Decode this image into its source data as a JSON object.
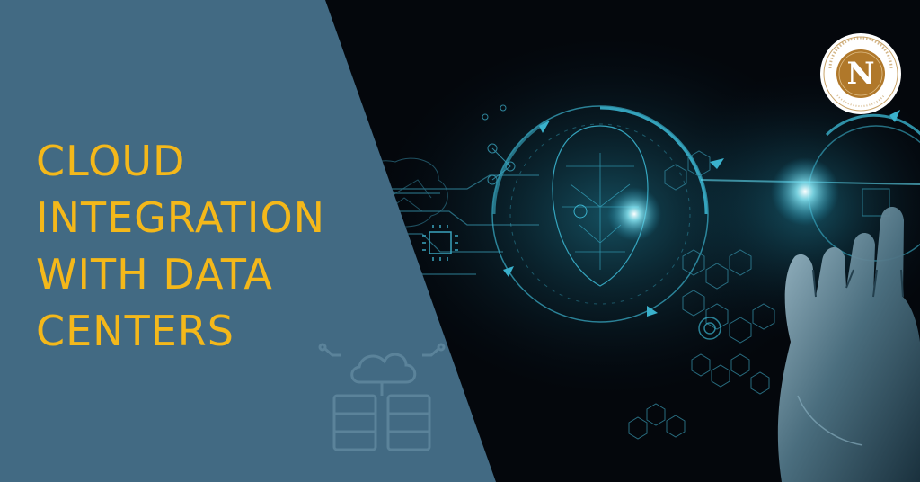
{
  "headline": {
    "lines": [
      "CLOUD",
      "INTEGRATION",
      "WITH DATA",
      "CENTERS"
    ]
  },
  "logo": {
    "letter": "N",
    "ring_text": "NEXT GENERATION GLOBAL TECHNOLOGIES"
  },
  "colors": {
    "panel": "#426a83",
    "headline": "#f4b81a",
    "background": "#04070c",
    "accent_glow": "#37d7f0",
    "logo_gold": "#b0782a"
  },
  "icons": [
    "cloud-server-icon",
    "ai-face-icon",
    "robot-hand-icon",
    "brain-icon",
    "chip-icon",
    "hexagon-pattern"
  ]
}
